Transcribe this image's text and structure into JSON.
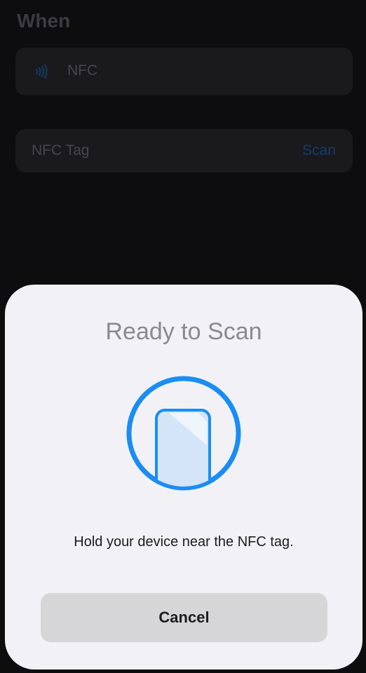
{
  "background": {
    "section_title": "When",
    "trigger": {
      "icon": "nfc-icon",
      "label": "NFC"
    },
    "tag_row": {
      "label": "NFC Tag",
      "action_label": "Scan"
    }
  },
  "sheet": {
    "title": "Ready to Scan",
    "graphic_icon": "phone-in-circle-icon",
    "instruction": "Hold your device near the NFC tag.",
    "cancel_label": "Cancel"
  },
  "colors": {
    "background": "#0d0d0f",
    "sheet": "#f2f2f6",
    "accent_blue": "#1a8df5",
    "button_gray": "#d6d6d9"
  }
}
